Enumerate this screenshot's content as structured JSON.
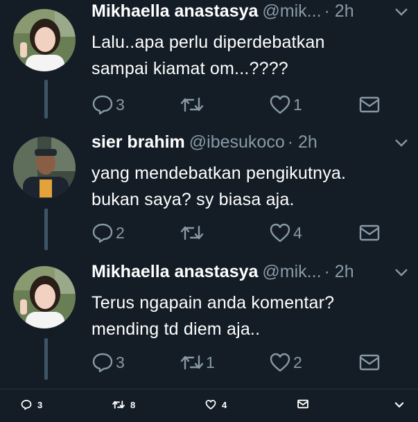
{
  "tweets": [
    {
      "name": "Mikhaella anastasya",
      "handle": "@mik...",
      "time": "· 2h",
      "lines": [
        "Lalu..apa perlu diperdebatkan",
        "sampai kiamat om...????"
      ],
      "replies": "3",
      "retweets": "",
      "likes": "1"
    },
    {
      "name": "sier brahim",
      "handle": "@ibesukoco",
      "time": "· 2h",
      "lines": [
        "yang mendebatkan pengikutnya.",
        "bukan saya? sy biasa aja."
      ],
      "replies": "2",
      "retweets": "",
      "likes": "4"
    },
    {
      "name": "Mikhaella anastasya",
      "handle": "@mik...",
      "time": "· 2h",
      "lines": [
        "Terus ngapain anda komentar?",
        "mending td diem aja.."
      ],
      "replies": "3",
      "retweets": "1",
      "likes": "2"
    }
  ],
  "bottom_bar": {
    "replies": "3",
    "retweets": "8",
    "likes": "4"
  },
  "icons": {
    "reply": "reply-icon",
    "retweet": "retweet-icon",
    "like": "heart-icon",
    "message": "envelope-icon",
    "more": "chevron-down-icon"
  },
  "colors": {
    "background": "#141d26",
    "muted": "#8899a6",
    "thread_line": "#3d5466"
  }
}
